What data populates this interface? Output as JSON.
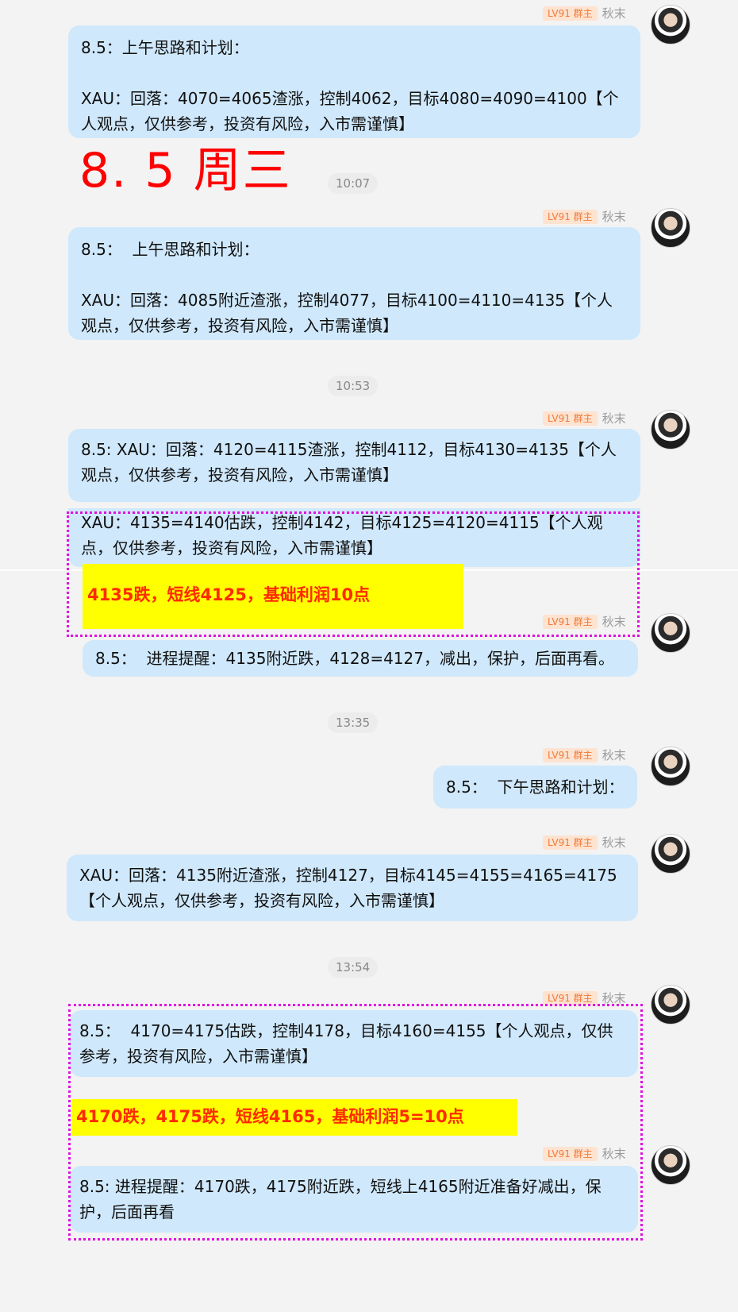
{
  "sender": {
    "badge": "LV91 群主",
    "name": "秋末"
  },
  "messages": [
    {
      "text": "8.5：上午思路和计划：\n\nXAU：回落：4070=4065渣涨，控制4062，目标4080=4090=4100【个人观点，仅供参考，投资有风险，入市需谨慎】"
    },
    {
      "text": "8.5：  上午思路和计划：\n\nXAU：回落：4085附近渣涨，控制4077，目标4100=4110=4135【个人观点，仅供参考，投资有风险，入市需谨慎】"
    },
    {
      "text": "8.5: XAU：回落：4120=4115渣涨，控制4112，目标4130=4135【个人观点，仅供参考，投资有风险，入市需谨慎】"
    },
    {
      "text": "XAU：4135=4140估跌，控制4142，目标4125=4120=4115【个人观点，仅供参考，投资有风险，入市需谨慎】"
    },
    {
      "text": "8.5：  进程提醒：4135附近跌，4128=4127，减出，保护，后面再看。"
    },
    {
      "text": "8.5：  下午思路和计划："
    },
    {
      "text": "XAU：回落：4135附近渣涨，控制4127，目标4145=4155=4165=4175【个人观点，仅供参考，投资有风险，入市需谨慎】"
    },
    {
      "text": "8.5：  4170=4175估跌，控制4178，目标4160=4155【个人观点，仅供参考，投资有风险，入市需谨慎】"
    },
    {
      "text": "8.5: 进程提醒：4170跌，4175附近跌，短线上4165附近准备好减出，保护，后面再看"
    }
  ],
  "date_heading": "8. 5  周三",
  "timestamps": [
    "10:07",
    "10:53",
    "13:35",
    "13:54"
  ],
  "highlights": [
    "4135跌，短线4125，基础利润10点",
    "4170跌，4175跌，短线4165，基础利润5=10点"
  ],
  "colors": {
    "bubble": "#cfe8fb",
    "highlight_bg": "#ffff00",
    "highlight_text": "#ff2a00",
    "dotted_border": "#e011e0",
    "heading": "#ff0000"
  }
}
